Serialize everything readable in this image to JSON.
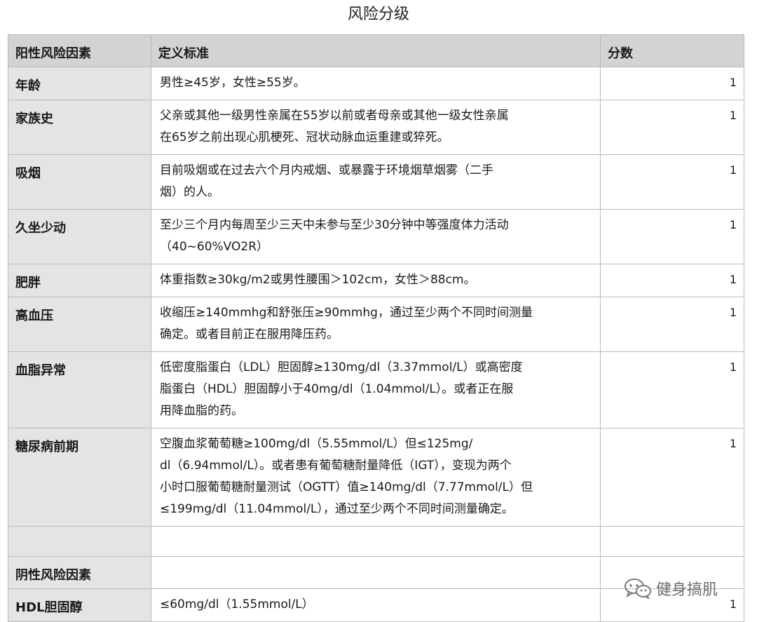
{
  "title": "风险分级",
  "headers": [
    "阳性风险因素",
    "定义标准",
    "分数"
  ],
  "rows": [
    {
      "factor": "年龄",
      "lines": [
        "男性≥45岁，女性≥55岁。"
      ],
      "score": "1"
    },
    {
      "factor": "家族史",
      "lines": [
        "父亲或其他一级男性亲属在55岁以前或者母亲或其他一级女性亲属",
        "在65岁之前出现心肌梗死、冠状动脉血运重建或猝死。"
      ],
      "score": "1"
    },
    {
      "factor": "吸烟",
      "lines": [
        "目前吸烟或在过去六个月内戒烟、或暴露于环境烟草烟雾（二手",
        "烟）的人。"
      ],
      "score": "1"
    },
    {
      "factor": "久坐少动",
      "lines": [
        "至少三个月内每周至少三天中未参与至少30分钟中等强度体力活动",
        "（40~60%VO2R）"
      ],
      "score": "1"
    },
    {
      "factor": "肥胖",
      "lines": [
        "体重指数≥30kg/m2或男性腰围＞102cm，女性＞88cm。"
      ],
      "score": "1"
    },
    {
      "factor": "高血压",
      "lines": [
        "收缩压≥140mmhg和舒张压≥90mmhg，通过至少两个不同时间测量",
        "确定。或者目前正在服用降压药。"
      ],
      "score": "1"
    },
    {
      "factor": "血脂异常",
      "lines": [
        "低密度脂蛋白（LDL）胆固醇≥130mg/dl（3.37mmol/L）或高密度",
        "脂蛋白（HDL）胆固醇小于40mg/dl（1.04mmol/L）。或者正在服",
        "用降血脂的药。"
      ],
      "score": "1"
    },
    {
      "factor": "糖尿病前期",
      "lines": [
        "空腹血浆葡萄糖≥100mg/dl（5.55mmol/L）但≤125mg/",
        "dl（6.94mmol/L）。或者患有葡萄糖耐量降低（IGT），变现为两个",
        "小时口服葡萄糖耐量测试（OGTT）值≥140mg/dl（7.77mmol/L）但",
        "≤199mg/dl（11.04mmol/L），通过至少两个不同时间测量确定。"
      ],
      "score": "1"
    },
    {
      "factor": "",
      "lines": [
        ""
      ],
      "score": ""
    },
    {
      "factor": "阴性风险因素",
      "lines": [
        ""
      ],
      "score": ""
    },
    {
      "factor": "HDL胆固醇",
      "lines": [
        "≤60mg/dl（1.55mmol/L）"
      ],
      "score": "1"
    }
  ],
  "watermark": {
    "text": "健身搞肌",
    "icon": "wechat-icon"
  }
}
